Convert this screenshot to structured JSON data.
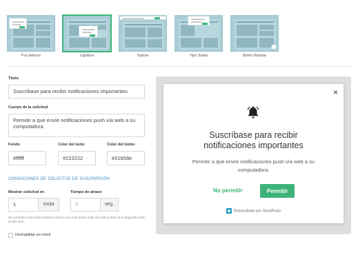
{
  "templates": [
    {
      "label": "Por defecto",
      "selected": false
    },
    {
      "label": "Lightbox",
      "selected": true
    },
    {
      "label": "Topline",
      "selected": false
    },
    {
      "label": "Tipo Safari",
      "selected": false
    },
    {
      "label": "Botón flotante",
      "selected": false
    }
  ],
  "form": {
    "title_label": "Título",
    "title_value": "Suscríbase para recibir notificaciones importantes",
    "body_label": "Cuerpo de la solicitud",
    "body_value": "Permitir a  que envíe notificaciones push vía web a su computadora.",
    "bg_label": "Fondo",
    "bg_value": "#ffffff",
    "text_color_label": "Color del texto",
    "text_color_value": "#222222",
    "button_color_label": "Color del botón",
    "button_color_value": "#31b58e",
    "conditions_title": "CONDICIONES DE SOLICITUD DE SUSCRIPCIÓN",
    "show_label": "Mostrar solicitud en",
    "show_value": "1",
    "show_suffix": "visita",
    "delay_label": "Tiempo de atraso",
    "delay_placeholder": "0",
    "delay_suffix": "seg.",
    "note": "Se considera una buena práctica ofrecer una suscripción push vía web a partir de la segunda visita al sitio web",
    "mobile_label": "Deshabilitar en móvil"
  },
  "preview": {
    "close": "×",
    "icon": "bell-icon",
    "title": "Suscríbase para recibir notificaciones importantes",
    "body": "Permitir a que envíe notificaciones push vía web a su computadora.",
    "deny_label": "No permitir",
    "allow_label": "Permitir",
    "powered_by": "Desarrollado por SendPulse"
  },
  "colors": {
    "accent": "#3db37a",
    "section": "#3a87c4",
    "thumb": "#a9cdd6"
  }
}
